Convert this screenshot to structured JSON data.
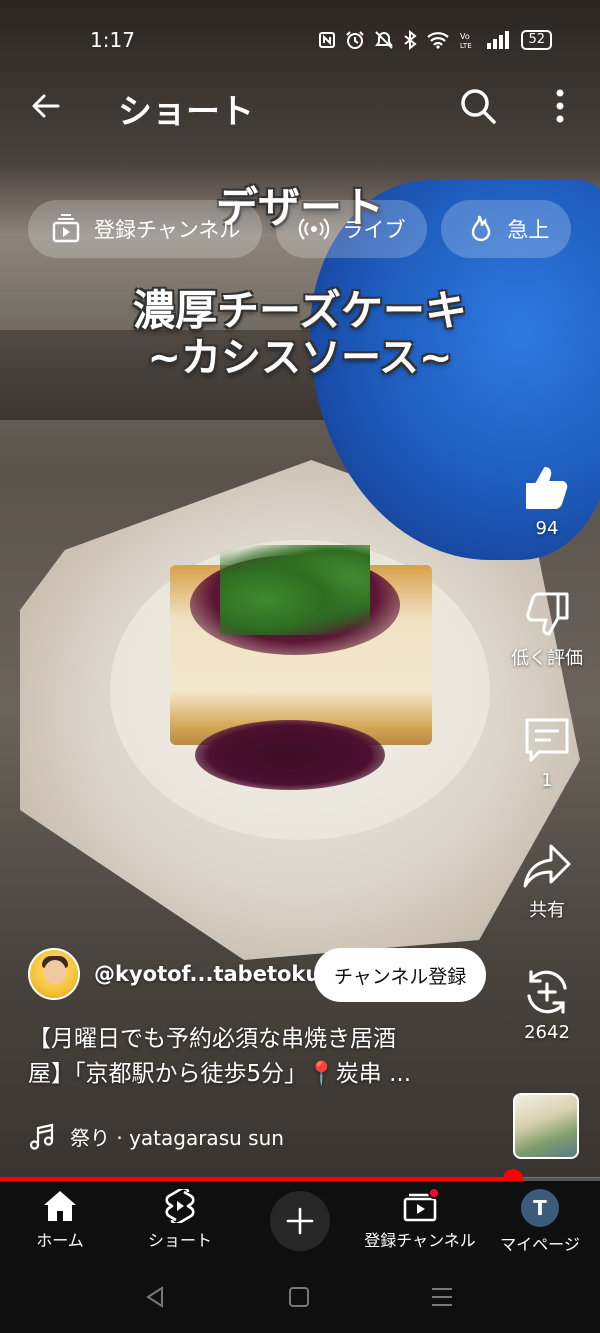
{
  "status_bar": {
    "time": "1:17",
    "icons": [
      "nfc-icon",
      "alarm-icon",
      "mute-icon",
      "bluetooth-icon",
      "wifi-icon",
      "volte-icon",
      "signal-icon"
    ],
    "battery": "52"
  },
  "header": {
    "title": "ショート"
  },
  "chips": [
    {
      "label": "登録チャンネル",
      "icon": "subscriptions-icon"
    },
    {
      "label": "ライブ",
      "icon": "live-icon"
    },
    {
      "label": "急上",
      "icon": "trending-icon"
    }
  ],
  "video_overlay": {
    "line1": "デザート",
    "line2": "濃厚チーズケーキ",
    "line3": "~カシスソース~"
  },
  "actions": {
    "like_count": "94",
    "dislike_label": "低く評価",
    "comment_count": "1",
    "share_label": "共有",
    "remix_count": "2642"
  },
  "channel": {
    "name": "@kyotof...tabetoku",
    "subscribe_label": "チャンネル登録"
  },
  "description": {
    "line1": "【月曜日でも予約必須な串焼き居酒",
    "line2": "屋】「京都駅から徒歩5分」📍炭串 ..."
  },
  "music": {
    "title": "祭り · yatagarasu sun"
  },
  "progress": {
    "fraction": 0.855,
    "color": "#ff0000"
  },
  "bottom_nav": {
    "home": "ホーム",
    "shorts": "ショート",
    "subscriptions": "登録チャンネル",
    "profile": "マイページ",
    "profile_initial": "T"
  },
  "colors": {
    "accent": "#ff0000",
    "background": "#0f0f0f"
  }
}
